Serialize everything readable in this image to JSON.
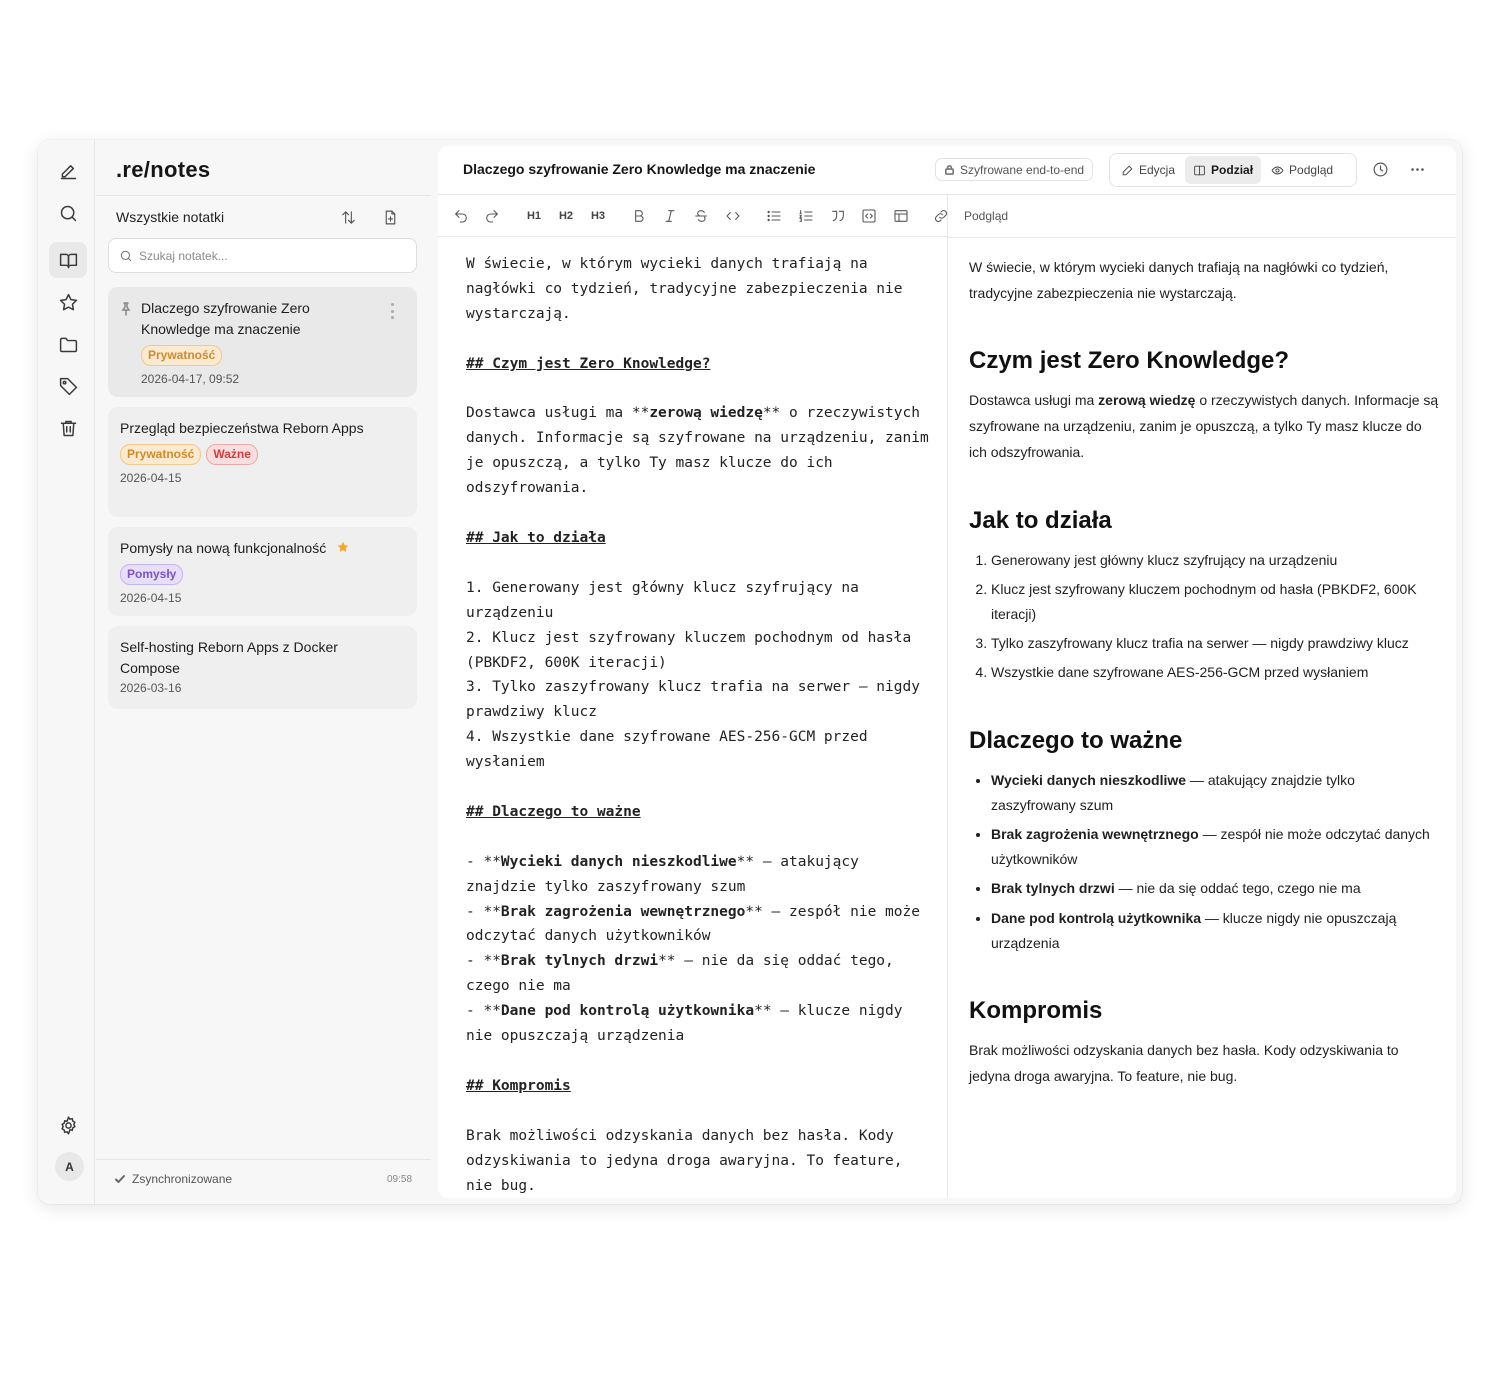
{
  "app": {
    "logo": ".re/notes"
  },
  "rail": {
    "items": [
      {
        "name": "new-note",
        "icon": "pencil-icon"
      },
      {
        "name": "search",
        "icon": "search-icon"
      },
      {
        "name": "notes",
        "icon": "book-icon",
        "active": true
      },
      {
        "name": "favorites",
        "icon": "star-icon"
      },
      {
        "name": "folders",
        "icon": "folder-icon"
      },
      {
        "name": "tags",
        "icon": "tag-icon"
      },
      {
        "name": "trash",
        "icon": "trash-icon"
      },
      {
        "name": "settings",
        "icon": "gear-icon"
      }
    ],
    "avatar": "A"
  },
  "notes_list": {
    "title": "Wszystkie notatki",
    "search_placeholder": "Szukaj notatek...",
    "notes": [
      {
        "title": "Dlaczego szyfrowanie Zero Knowledge ma znaczenie",
        "tags": [
          "Prywatność"
        ],
        "date": "2026-04-17, 09:52",
        "pinned": true
      },
      {
        "title": "Przegląd bezpieczeństwa Reborn Apps",
        "tags": [
          "Prywatność",
          "Ważne"
        ],
        "date": "2026-04-15"
      },
      {
        "title": "Pomysły na nową funkcjonalność",
        "tags": [
          "Pomysły"
        ],
        "date": "2026-04-15",
        "starred": true
      },
      {
        "title": "Self-hosting Reborn Apps z Docker Compose",
        "tags": [],
        "date": "2026-03-16"
      }
    ],
    "sync_status": "Zsynchronizowane",
    "sync_time": "09:58"
  },
  "editor": {
    "title": "Dlaczego szyfrowanie Zero Knowledge ma znaczenie",
    "encryption_badge": "Szyfrowane end-to-end",
    "modes": [
      "Edycja",
      "Podział",
      "Podgląd"
    ],
    "active_mode": "Podział",
    "toolbar": {
      "h1": "H1",
      "h2": "H2",
      "h3": "H3"
    },
    "preview_label": "Podgląd",
    "source": {
      "intro": "W świecie, w którym wycieki danych trafiają na nagłówki co tydzień, tradycyjne zabezpieczenia nie wystarczają.",
      "h_zk": "## Czym jest Zero Knowledge?",
      "p_zk_1": "Dostawca usługi ma **",
      "p_zk_bold": "zerową wiedzę",
      "p_zk_2": "** o rzeczywistych danych. Informacje są szyfrowane na urządzeniu, zanim je opuszczą, a tylko Ty masz klucze do ich odszyfrowania.",
      "h_how": "## Jak to działa",
      "steps": [
        "1. Generowany jest główny klucz szyfrujący na urządzeniu",
        "2. Klucz jest szyfrowany kluczem pochodnym od hasła (PBKDF2, 600K iteracji)",
        "3. Tylko zaszyfrowany klucz trafia na serwer — nigdy prawdziwy klucz",
        "4. Wszystkie dane szyfrowane AES-256-GCM przed wysłaniem"
      ],
      "h_why": "## Dlaczego to ważne",
      "bullets": [
        {
          "prefix": "- **",
          "bold": "Wycieki danych nieszkodliwe",
          "rest": "** — atakujący znajdzie tylko zaszyfrowany szum"
        },
        {
          "prefix": "- **",
          "bold": "Brak zagrożenia wewnętrznego",
          "rest": "** — zespół nie może odczytać danych użytkowników"
        },
        {
          "prefix": "- **",
          "bold": "Brak tylnych drzwi",
          "rest": "** — nie da się oddać tego, czego nie ma"
        },
        {
          "prefix": "- **",
          "bold": "Dane pod kontrolą użytkownika",
          "rest": "** — klucze nigdy nie opuszczają urządzenia"
        }
      ],
      "h_komp": "## Kompromis",
      "komp": "Brak możliwości odzyskania danych bez hasła. Kody odzyskiwania to jedyna droga awaryjna. To feature, nie bug."
    },
    "preview": {
      "intro": "W świecie, w którym wycieki danych trafiają na nagłówki co tydzień, tradycyjne zabezpieczenia nie wystarczają.",
      "h_zk": "Czym jest Zero Knowledge?",
      "p_zk_1": "Dostawca usługi ma ",
      "p_zk_bold": "zerową wiedzę",
      "p_zk_2": " o rzeczywistych danych. Informacje są szyfrowane na urządzeniu, zanim je opuszczą, a tylko Ty masz klucze do ich odszyfrowania.",
      "h_how": "Jak to działa",
      "steps": [
        "Generowany jest główny klucz szyfrujący na urządzeniu",
        "Klucz jest szyfrowany kluczem pochodnym od hasła (PBKDF2, 600K iteracji)",
        "Tylko zaszyfrowany klucz trafia na serwer — nigdy prawdziwy klucz",
        "Wszystkie dane szyfrowane AES-256-GCM przed wysłaniem"
      ],
      "h_why": "Dlaczego to ważne",
      "bullets": [
        {
          "bold": "Wycieki danych nieszkodliwe",
          "rest": " — atakujący znajdzie tylko zaszyfrowany szum"
        },
        {
          "bold": "Brak zagrożenia wewnętrznego",
          "rest": " — zespół nie może odczytać danych użytkowników"
        },
        {
          "bold": "Brak tylnych drzwi",
          "rest": " — nie da się oddać tego, czego nie ma"
        },
        {
          "bold": "Dane pod kontrolą użytkownika",
          "rest": " — klucze nigdy nie opuszczają urządzenia"
        }
      ],
      "h_komp": "Kompromis",
      "komp": "Brak możliwości odzyskania danych bez hasła. Kody odzyskiwania to jedyna droga awaryjna. To feature, nie bug."
    }
  },
  "colors": {
    "tag_privacy": "#d28a2a",
    "tag_important": "#d03e3e",
    "tag_ideas": "#7a55c8",
    "star": "#f5a623"
  }
}
